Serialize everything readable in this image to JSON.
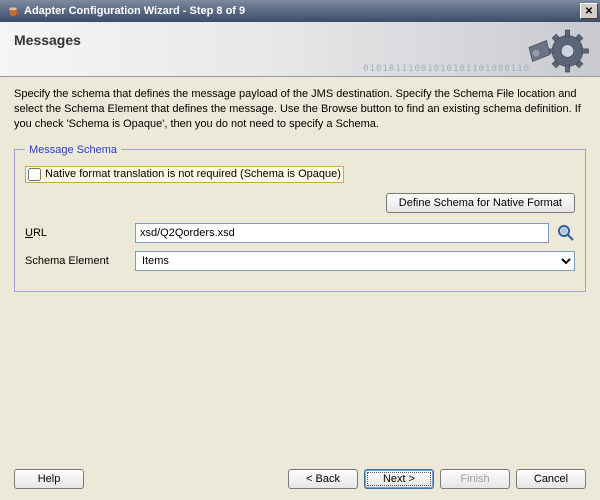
{
  "window": {
    "title": "Adapter Configuration Wizard - Step 8 of 9"
  },
  "header": {
    "title": "Messages",
    "digits": "01010111001010101101000110"
  },
  "description": "Specify the schema that defines the message payload of the JMS destination.  Specify the Schema File location and select the Schema Element that defines the message. Use the Browse button to find an existing schema definition. If you check 'Schema is Opaque', then you do not need to specify a Schema.",
  "fieldset": {
    "legend": "Message Schema",
    "opaque_label": "Native format translation is not required (Schema is Opaque)",
    "opaque_checked": false,
    "define_button": "Define Schema for Native Format",
    "url_label_prefix": "U",
    "url_label_rest": "RL",
    "url_value": "xsd/Q2Qorders.xsd",
    "schema_label": "Schema Element",
    "schema_value": "Items"
  },
  "footer": {
    "help": "Help",
    "back": "< Back",
    "next": "Next >",
    "finish": "Finish",
    "cancel": "Cancel"
  }
}
